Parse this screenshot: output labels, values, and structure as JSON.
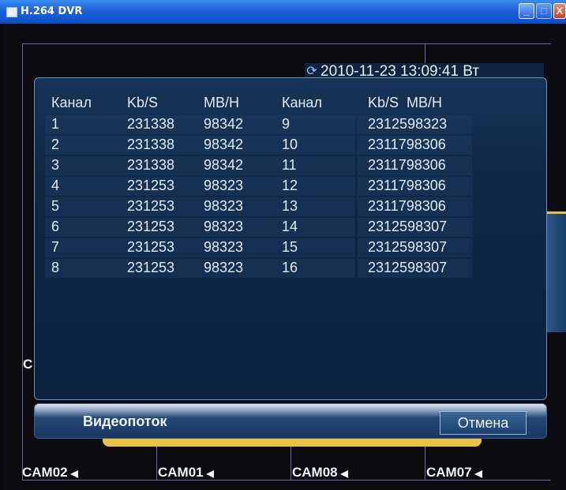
{
  "window": {
    "title": "H.264 DVR",
    "buttons": {
      "minimize": "_",
      "maximize": "□",
      "close": "X"
    }
  },
  "datetime": {
    "icon": "refresh-icon",
    "text": "2010-11-23 13:09:41 Вт"
  },
  "table": {
    "headers": [
      "Канал",
      "Kb/S",
      "MB/H",
      "Канал",
      "Kb/S  MB/H"
    ],
    "rows": [
      {
        "ch1": "1",
        "kbs1": "231338",
        "mbh1": "98342",
        "ch2": "9",
        "combo2": "2312598323"
      },
      {
        "ch1": "2",
        "kbs1": "231338",
        "mbh1": "98342",
        "ch2": "10",
        "combo2": "2311798306"
      },
      {
        "ch1": "3",
        "kbs1": "231338",
        "mbh1": "98342",
        "ch2": "11",
        "combo2": "2311798306"
      },
      {
        "ch1": "4",
        "kbs1": "231253",
        "mbh1": "98323",
        "ch2": "12",
        "combo2": "2311798306"
      },
      {
        "ch1": "5",
        "kbs1": "231253",
        "mbh1": "98323",
        "ch2": "13",
        "combo2": "2311798306"
      },
      {
        "ch1": "6",
        "kbs1": "231253",
        "mbh1": "98323",
        "ch2": "14",
        "combo2": "2312598307"
      },
      {
        "ch1": "7",
        "kbs1": "231253",
        "mbh1": "98323",
        "ch2": "15",
        "combo2": "2312598307"
      },
      {
        "ch1": "8",
        "kbs1": "231253",
        "mbh1": "98323",
        "ch2": "16",
        "combo2": "2312598307"
      }
    ]
  },
  "bottom": {
    "label": "Видеопоток",
    "cancel_label": "Отмена"
  },
  "cameras": [
    {
      "label": "CAM02"
    },
    {
      "label": "CAM01"
    },
    {
      "label": "CAM08"
    },
    {
      "label": "CAM07"
    }
  ],
  "partial_letter": "C",
  "colors": {
    "dialog_bg": "#0e2846",
    "accent_yellow": "#e8c341",
    "grid_line": "#7b5fa8",
    "titlebar": "#1e63d9"
  }
}
